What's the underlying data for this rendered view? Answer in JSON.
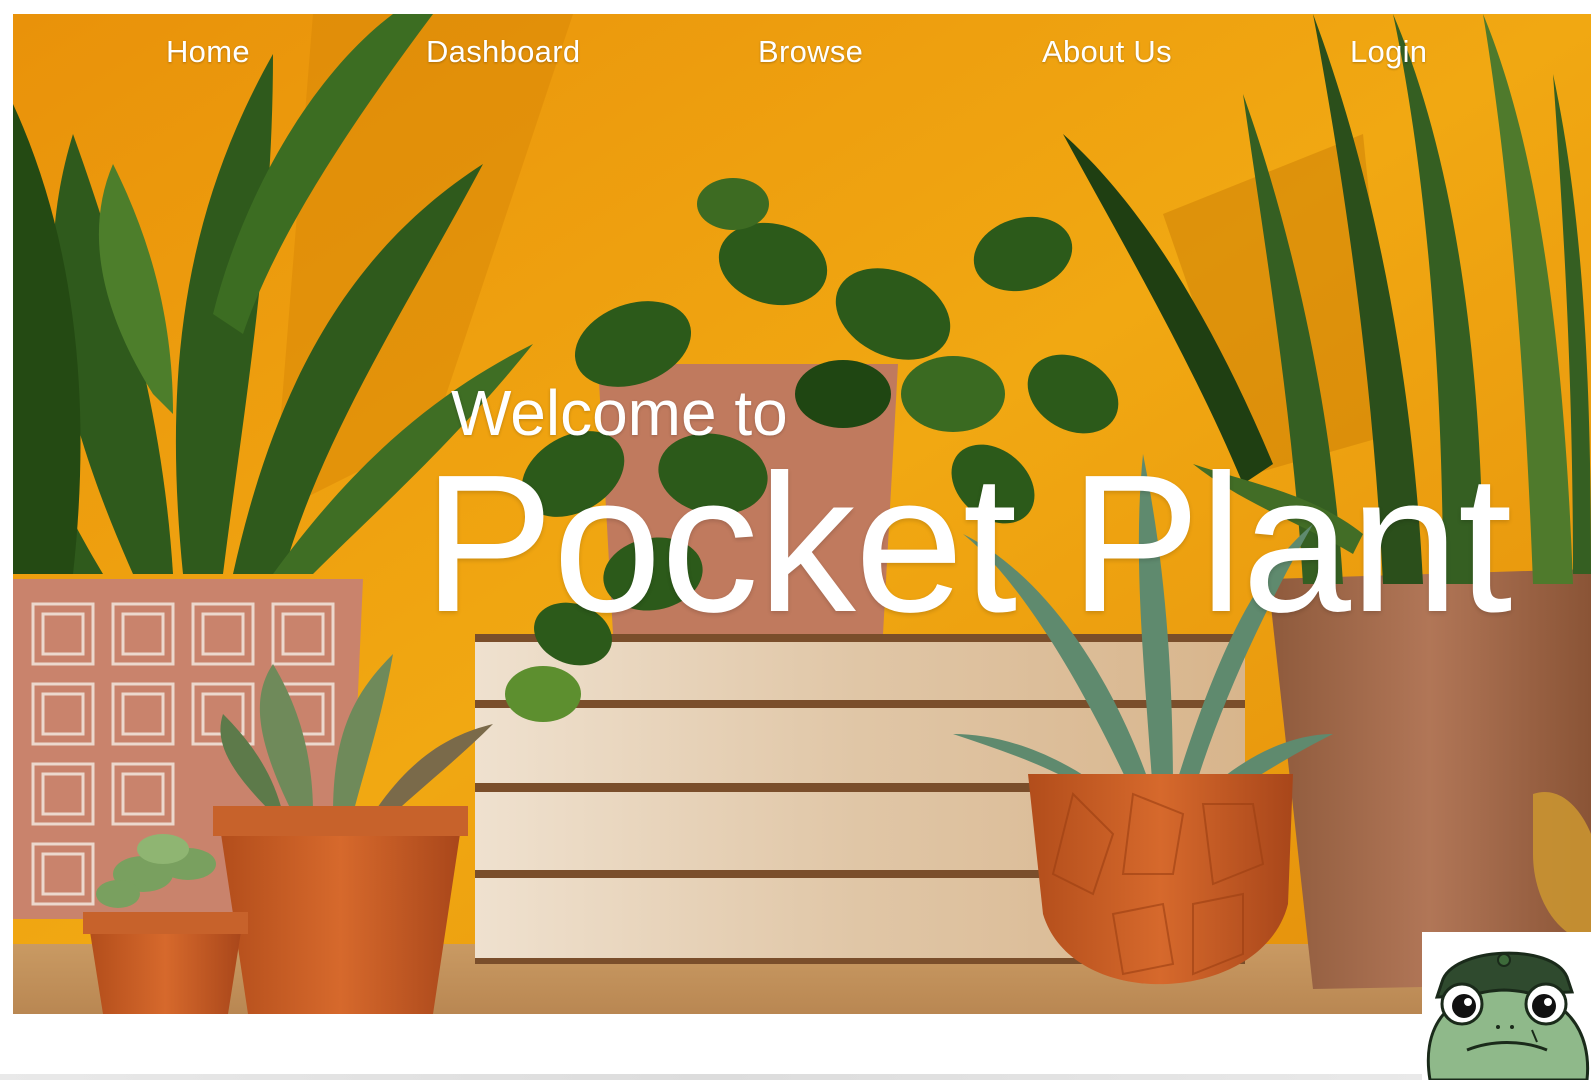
{
  "nav": {
    "items": [
      {
        "label": "Home"
      },
      {
        "label": "Dashboard"
      },
      {
        "label": "Browse"
      },
      {
        "label": "About Us"
      },
      {
        "label": "Login"
      }
    ]
  },
  "hero": {
    "welcome": "Welcome to",
    "brand": "Pocket Plant",
    "background_icon": "houseplants-photo"
  },
  "mascot": {
    "icon": "frog-mascot-icon"
  },
  "colors": {
    "wall": "#eea30f",
    "nav_text": "#ffffff",
    "terracotta": "#c9622a",
    "leaf": "#2f5a1c"
  }
}
